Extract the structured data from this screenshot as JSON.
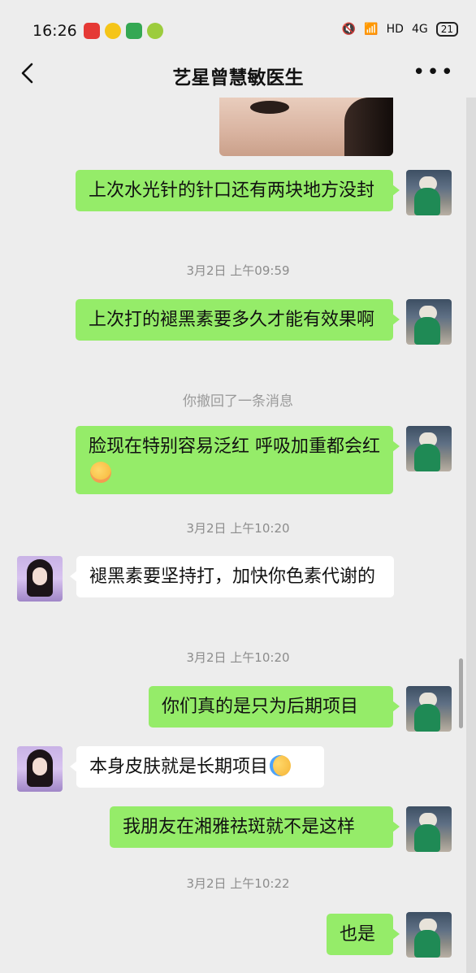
{
  "status": {
    "time": "16:26",
    "network": "HD",
    "signal": "4G",
    "battery": "21"
  },
  "nav": {
    "title": "艺星曾慧敏医生",
    "more": "•••"
  },
  "messages": [
    {
      "from": "me",
      "text": "上次水光针的针口还有两块地方没封"
    },
    {
      "type": "time",
      "text": "3月2日 上午09:59"
    },
    {
      "from": "me",
      "text": "上次打的褪黑素要多久才能有效果啊"
    },
    {
      "type": "notice",
      "text": "你撤回了一条消息"
    },
    {
      "from": "me",
      "text": "脸现在特别容易泛红 呼吸加重都会红"
    },
    {
      "type": "time",
      "text": "3月2日 上午10:20"
    },
    {
      "from": "other",
      "text": "褪黑素要坚持打，加快你色素代谢的"
    },
    {
      "type": "time",
      "text": "3月2日 上午10:20"
    },
    {
      "from": "me",
      "text": "你们真的是只为后期项目"
    },
    {
      "from": "other",
      "text": "本身皮肤就是长期项目"
    },
    {
      "from": "me",
      "text": "我朋友在湘雅祛斑就不是这样"
    },
    {
      "type": "time",
      "text": "3月2日 上午10:22"
    },
    {
      "from": "me",
      "text": "也是"
    }
  ],
  "emoji": {
    "m3": "flushed-emoji",
    "m9": "crying-emoji"
  },
  "colors": {
    "background": "#ededed",
    "my_bubble": "#95ec69",
    "other_bubble": "#ffffff"
  }
}
